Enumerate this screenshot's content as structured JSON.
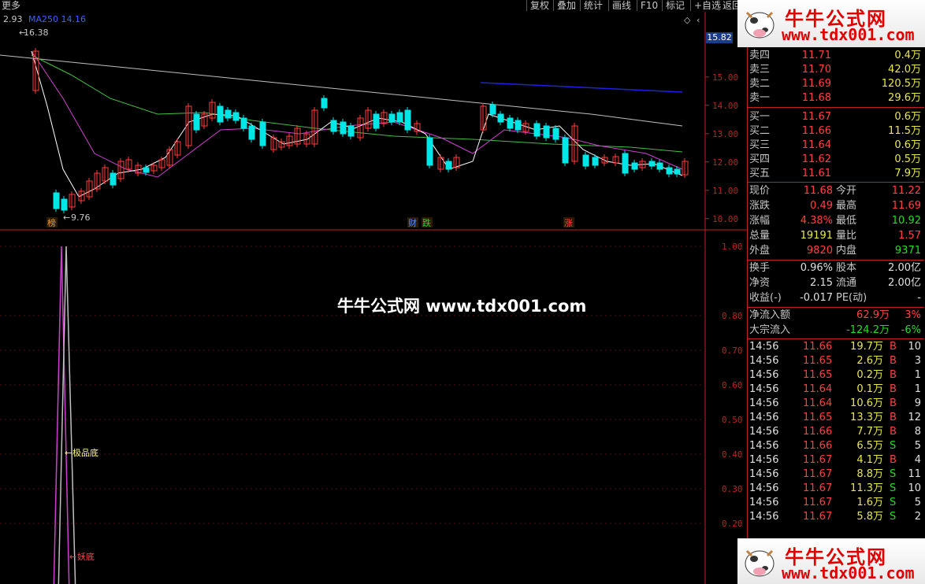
{
  "toolbar": {
    "more": "更多",
    "buttons": [
      "复权",
      "叠加",
      "统计",
      "画线",
      "F10",
      "标记",
      "+自选",
      "返回"
    ]
  },
  "indicator_bar": {
    "value": "2.93",
    "ma_label": "MA250",
    "ma_value": "14.16"
  },
  "price_chart": {
    "high_marker": "16.38",
    "low_marker": "9.76",
    "current_price_tag": "15.82",
    "y_ticks": [
      "15.00",
      "14.00",
      "13.00",
      "12.00",
      "11.00",
      "10.00"
    ],
    "event_tags": [
      "榜",
      "财",
      "跌",
      "涨"
    ]
  },
  "sub_chart": {
    "y_ticks": [
      "1.00",
      "0.80",
      "0.70",
      "0.60",
      "0.50",
      "0.40",
      "0.30",
      "0.20"
    ],
    "label_top": "极品底",
    "label_bottom": "妖底"
  },
  "watermark": {
    "center": "牛牛公式网 www.tdx001.com",
    "banner_title": "牛牛公式网",
    "banner_url": "www.tdx001.com"
  },
  "quote": {
    "asks": [
      {
        "label": "卖四",
        "price": "11.71",
        "vol": "0.4万"
      },
      {
        "label": "卖三",
        "price": "11.70",
        "vol": "42.0万"
      },
      {
        "label": "卖二",
        "price": "11.69",
        "vol": "120.5万"
      },
      {
        "label": "卖一",
        "price": "11.68",
        "vol": "29.6万"
      }
    ],
    "bids": [
      {
        "label": "买一",
        "price": "11.67",
        "vol": "0.6万"
      },
      {
        "label": "买二",
        "price": "11.66",
        "vol": "11.5万"
      },
      {
        "label": "买三",
        "price": "11.64",
        "vol": "0.6万"
      },
      {
        "label": "买四",
        "price": "11.62",
        "vol": "0.5万"
      },
      {
        "label": "买五",
        "price": "11.61",
        "vol": "7.9万"
      }
    ],
    "stats": [
      {
        "l1": "现价",
        "v1": "11.68",
        "l2": "今开",
        "v2": "11.22"
      },
      {
        "l1": "涨跌",
        "v1": "0.49",
        "l2": "最高",
        "v2": "11.69"
      },
      {
        "l1": "涨幅",
        "v1": "4.38%",
        "l2": "最低",
        "v2": "10.92"
      },
      {
        "l1": "总量",
        "v1": "19191",
        "l2": "量比",
        "v2": "1.57"
      },
      {
        "l1": "外盘",
        "v1": "9820",
        "l2": "内盘",
        "v2": "9371"
      }
    ],
    "stats2": [
      {
        "l1": "换手",
        "v1": "0.96%",
        "l2": "股本",
        "v2": "2.00亿"
      },
      {
        "l1": "净资",
        "v1": "2.15",
        "l2": "流通",
        "v2": "2.00亿"
      },
      {
        "l1": "收益(-)",
        "v1": "-0.017",
        "l2": "PE(动)",
        "v2": "-"
      }
    ],
    "flows": [
      {
        "label": "净流入额",
        "value": "62.9万",
        "pct": "3%"
      },
      {
        "label": "大宗流入",
        "value": "-124.2万",
        "pct": "-6%"
      }
    ]
  },
  "ticks": [
    {
      "time": "14:56",
      "price": "11.66",
      "vol": "19.7万",
      "side": "B",
      "n": "10"
    },
    {
      "time": "14:56",
      "price": "11.65",
      "vol": "2.6万",
      "side": "B",
      "n": "3"
    },
    {
      "time": "14:56",
      "price": "11.65",
      "vol": "0.2万",
      "side": "B",
      "n": "1"
    },
    {
      "time": "14:56",
      "price": "11.64",
      "vol": "0.1万",
      "side": "B",
      "n": "1"
    },
    {
      "time": "14:56",
      "price": "11.64",
      "vol": "10.6万",
      "side": "B",
      "n": "9"
    },
    {
      "time": "14:56",
      "price": "11.65",
      "vol": "13.3万",
      "side": "B",
      "n": "12"
    },
    {
      "time": "14:56",
      "price": "11.66",
      "vol": "7.7万",
      "side": "B",
      "n": "8"
    },
    {
      "time": "14:56",
      "price": "11.66",
      "vol": "6.5万",
      "side": "S",
      "n": "5"
    },
    {
      "time": "14:56",
      "price": "11.67",
      "vol": "4.1万",
      "side": "B",
      "n": "4"
    },
    {
      "time": "14:56",
      "price": "11.67",
      "vol": "8.8万",
      "side": "S",
      "n": "11"
    },
    {
      "time": "14:56",
      "price": "11.67",
      "vol": "11.3万",
      "side": "S",
      "n": "10"
    },
    {
      "time": "14:56",
      "price": "11.67",
      "vol": "1.6万",
      "side": "S",
      "n": "5"
    },
    {
      "time": "14:56",
      "price": "11.67",
      "vol": "5.8万",
      "side": "S",
      "n": "2"
    }
  ],
  "colors": {
    "up": "#ff3c3c",
    "down": "#00e5e5",
    "ma5": "#ffffff",
    "ma10": "#d040d0",
    "ma20": "#40c040",
    "ma60": "#c0c0c0",
    "blue": "#2020e0"
  }
}
